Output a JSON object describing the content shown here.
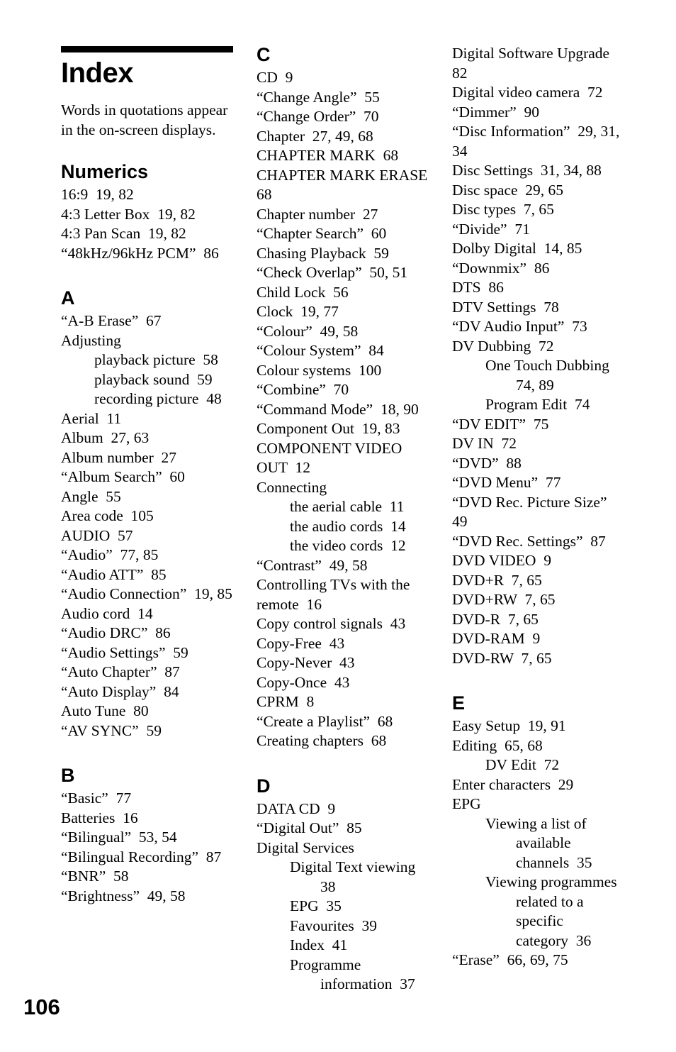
{
  "page": {
    "folio": "106",
    "title": "Index",
    "intro": "Words in quotations appear in the on-screen displays."
  },
  "columns": [
    {
      "id": "column-1",
      "sections": [
        {
          "heading": "Numerics",
          "entries": [
            {
              "text": "16:9  19, 82",
              "level": 0
            },
            {
              "text": "4:3 Letter Box  19, 82",
              "level": 0
            },
            {
              "text": "4:3 Pan Scan  19, 82",
              "level": 0
            },
            {
              "text": "“48kHz/96kHz PCM”  86",
              "level": 0
            }
          ]
        },
        {
          "heading": "A",
          "entries": [
            {
              "text": "“A-B Erase”  67",
              "level": 0
            },
            {
              "text": "Adjusting",
              "level": 0
            },
            {
              "text": "playback picture  58",
              "level": 1
            },
            {
              "text": "playback sound  59",
              "level": 1
            },
            {
              "text": "recording picture  48",
              "level": 1
            },
            {
              "text": "Aerial  11",
              "level": 0
            },
            {
              "text": "Album  27, 63",
              "level": 0
            },
            {
              "text": "Album number  27",
              "level": 0
            },
            {
              "text": "“Album Search”  60",
              "level": 0
            },
            {
              "text": "Angle  55",
              "level": 0
            },
            {
              "text": "Area code  105",
              "level": 0
            },
            {
              "text": "AUDIO  57",
              "level": 0
            },
            {
              "text": "“Audio”  77, 85",
              "level": 0
            },
            {
              "text": "“Audio ATT”  85",
              "level": 0
            },
            {
              "text": "“Audio Connection”  19, 85",
              "level": 0
            },
            {
              "text": "Audio cord  14",
              "level": 0
            },
            {
              "text": "“Audio DRC”  86",
              "level": 0
            },
            {
              "text": "“Audio Settings”  59",
              "level": 0
            },
            {
              "text": "“Auto Chapter”  87",
              "level": 0
            },
            {
              "text": "“Auto Display”  84",
              "level": 0
            },
            {
              "text": "Auto Tune  80",
              "level": 0
            },
            {
              "text": "“AV SYNC”  59",
              "level": 0
            }
          ]
        },
        {
          "heading": "B",
          "entries": [
            {
              "text": "“Basic”  77",
              "level": 0
            },
            {
              "text": "Batteries  16",
              "level": 0
            },
            {
              "text": "“Bilingual”  53, 54",
              "level": 0
            },
            {
              "text": "“Bilingual Recording”  87",
              "level": 0
            },
            {
              "text": "“BNR”  58",
              "level": 0
            },
            {
              "text": "“Brightness”  49, 58",
              "level": 0
            }
          ]
        }
      ]
    },
    {
      "id": "column-2",
      "sections": [
        {
          "heading": "C",
          "entries": [
            {
              "text": "CD  9",
              "level": 0
            },
            {
              "text": "“Change Angle”  55",
              "level": 0
            },
            {
              "text": "“Change Order”  70",
              "level": 0
            },
            {
              "text": "Chapter  27, 49, 68",
              "level": 0
            },
            {
              "text": "CHAPTER MARK  68",
              "level": 0
            },
            {
              "text": "CHAPTER MARK ERASE  68",
              "level": 0
            },
            {
              "text": "Chapter number  27",
              "level": 0
            },
            {
              "text": "“Chapter Search”  60",
              "level": 0
            },
            {
              "text": "Chasing Playback  59",
              "level": 0
            },
            {
              "text": "“Check Overlap”  50, 51",
              "level": 0
            },
            {
              "text": "Child Lock  56",
              "level": 0
            },
            {
              "text": "Clock  19, 77",
              "level": 0
            },
            {
              "text": "“Colour”  49, 58",
              "level": 0
            },
            {
              "text": "“Colour System”  84",
              "level": 0
            },
            {
              "text": "Colour systems  100",
              "level": 0
            },
            {
              "text": "“Combine”  70",
              "level": 0
            },
            {
              "text": "“Command Mode”  18, 90",
              "level": 0
            },
            {
              "text": "Component Out  19, 83",
              "level": 0
            },
            {
              "text": "COMPONENT VIDEO OUT  12",
              "level": 0
            },
            {
              "text": "Connecting",
              "level": 0
            },
            {
              "text": "the aerial cable  11",
              "level": 1
            },
            {
              "text": "the audio cords  14",
              "level": 1
            },
            {
              "text": "the video cords  12",
              "level": 1
            },
            {
              "text": "“Contrast”  49, 58",
              "level": 0
            },
            {
              "text": "Controlling TVs with the remote  16",
              "level": 0
            },
            {
              "text": "Copy control signals  43",
              "level": 0
            },
            {
              "text": "Copy-Free  43",
              "level": 0
            },
            {
              "text": "Copy-Never  43",
              "level": 0
            },
            {
              "text": "Copy-Once  43",
              "level": 0
            },
            {
              "text": "CPRM  8",
              "level": 0
            },
            {
              "text": "“Create a Playlist”  68",
              "level": 0
            },
            {
              "text": "Creating chapters  68",
              "level": 0
            }
          ]
        },
        {
          "heading": "D",
          "entries": [
            {
              "text": "DATA CD  9",
              "level": 0
            },
            {
              "text": "“Digital Out”  85",
              "level": 0
            },
            {
              "text": "Digital Services",
              "level": 0
            },
            {
              "text": "Digital Text viewing",
              "level": 1
            },
            {
              "text": "38",
              "level": 2
            },
            {
              "text": "EPG  35",
              "level": 1
            },
            {
              "text": "Favourites  39",
              "level": 1
            },
            {
              "text": "Index  41",
              "level": 1
            },
            {
              "text": "Programme",
              "level": 1
            },
            {
              "text": "information  37",
              "level": 2
            }
          ]
        }
      ]
    },
    {
      "id": "column-3",
      "sections": [
        {
          "heading": "",
          "entries": [
            {
              "text": "Digital Software Upgrade  82",
              "level": 0
            },
            {
              "text": "Digital video camera  72",
              "level": 0
            },
            {
              "text": "“Dimmer”  90",
              "level": 0
            },
            {
              "text": "“Disc Information”  29, 31, 34",
              "level": 0
            },
            {
              "text": "Disc Settings  31, 34, 88",
              "level": 0
            },
            {
              "text": "Disc space  29, 65",
              "level": 0
            },
            {
              "text": "Disc types  7, 65",
              "level": 0
            },
            {
              "text": "“Divide”  71",
              "level": 0
            },
            {
              "text": "Dolby Digital  14, 85",
              "level": 0
            },
            {
              "text": "“Downmix”  86",
              "level": 0
            },
            {
              "text": "DTS  86",
              "level": 0
            },
            {
              "text": "DTV Settings  78",
              "level": 0
            },
            {
              "text": "“DV Audio Input”  73",
              "level": 0
            },
            {
              "text": "DV Dubbing  72",
              "level": 0
            },
            {
              "text": "One Touch Dubbing",
              "level": 1
            },
            {
              "text": "74, 89",
              "level": 2
            },
            {
              "text": "Program Edit  74",
              "level": 1
            },
            {
              "text": "“DV EDIT”  75",
              "level": 0
            },
            {
              "text": "DV IN  72",
              "level": 0
            },
            {
              "text": "“DVD”  88",
              "level": 0
            },
            {
              "text": "“DVD Menu”  77",
              "level": 0
            },
            {
              "text": "“DVD Rec. Picture Size”  49",
              "level": 0
            },
            {
              "text": "“DVD Rec. Settings”  87",
              "level": 0
            },
            {
              "text": "DVD VIDEO  9",
              "level": 0
            },
            {
              "text": "DVD+R  7, 65",
              "level": 0
            },
            {
              "text": "DVD+RW  7, 65",
              "level": 0
            },
            {
              "text": "DVD-R  7, 65",
              "level": 0
            },
            {
              "text": "DVD-RAM  9",
              "level": 0
            },
            {
              "text": "DVD-RW  7, 65",
              "level": 0
            }
          ]
        },
        {
          "heading": "E",
          "entries": [
            {
              "text": "Easy Setup  19, 91",
              "level": 0
            },
            {
              "text": "Editing  65, 68",
              "level": 0
            },
            {
              "text": "DV Edit  72",
              "level": 1
            },
            {
              "text": "Enter characters  29",
              "level": 0
            },
            {
              "text": "EPG",
              "level": 0
            },
            {
              "text": "Viewing a list of",
              "level": 1
            },
            {
              "text": "available",
              "level": 2
            },
            {
              "text": "channels  35",
              "level": 2
            },
            {
              "text": "Viewing programmes",
              "level": 1
            },
            {
              "text": "related to a",
              "level": 2
            },
            {
              "text": "specific",
              "level": 2
            },
            {
              "text": "category  36",
              "level": 2
            },
            {
              "text": "“Erase”  66, 69, 75",
              "level": 0
            }
          ]
        }
      ]
    }
  ]
}
